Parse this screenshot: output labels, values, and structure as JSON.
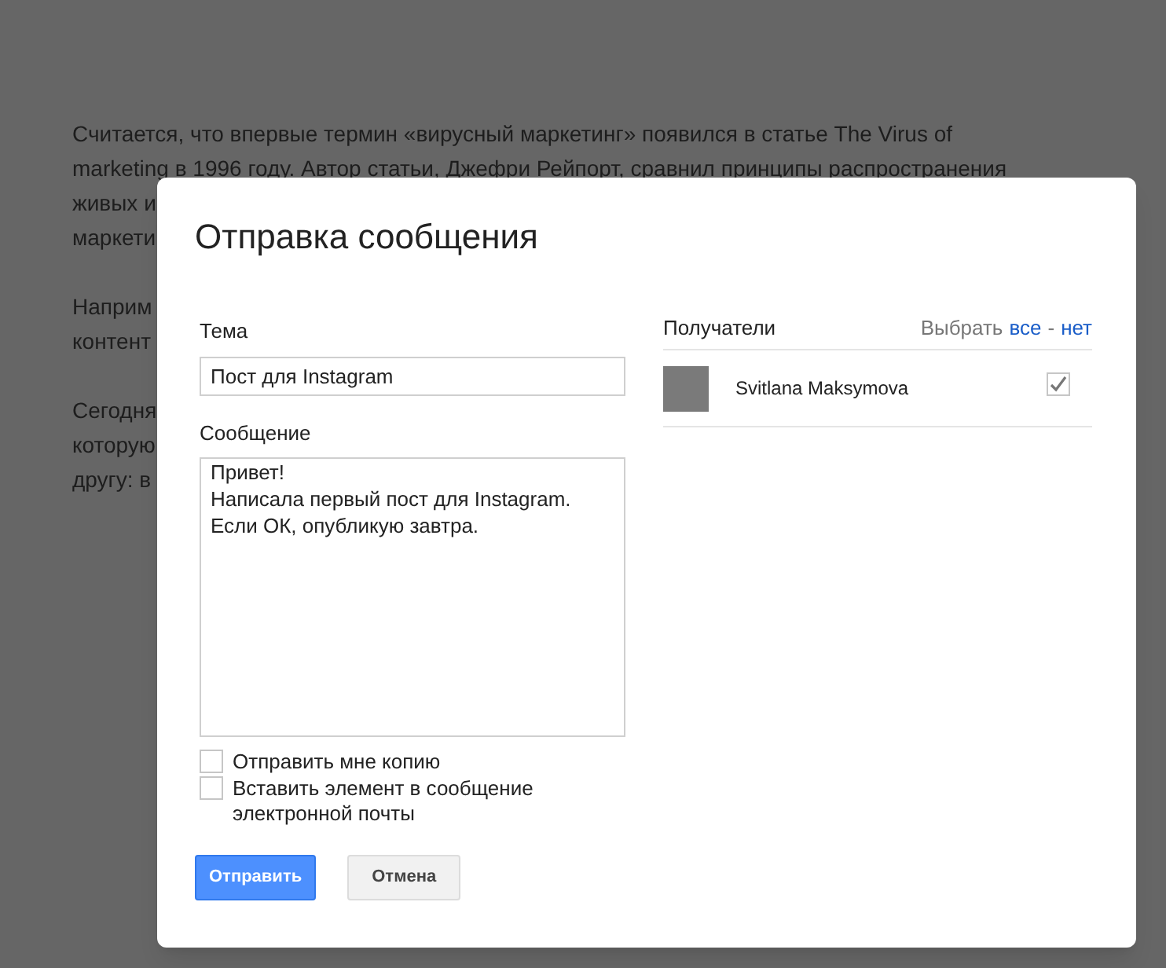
{
  "document": {
    "paragraphs": [
      {
        "lines": [
          {
            "text": "Считается, что впервые термин «вирусный маркетинг» появился в статье The Virus of"
          },
          {
            "text": "marketing в 1996 году. Автор статьи, ",
            "link": "Джефри Рейпорт",
            "after": ", сравнил принципы распространения"
          },
          {
            "text": "живых и"
          },
          {
            "text": "маркети"
          }
        ]
      },
      {
        "lines": [
          {
            "text": "Наприм"
          },
          {
            "text": "контент"
          }
        ]
      },
      {
        "lines": [
          {
            "text": "Сегодня"
          },
          {
            "text": "которую"
          },
          {
            "text": "другу: в"
          }
        ]
      }
    ]
  },
  "dialog": {
    "title": "Отправка сообщения",
    "subject": {
      "label": "Тема",
      "value": "Пост для Instagram"
    },
    "message": {
      "label": "Сообщение",
      "value": "Привет!\nНаписала первый пост для Instagram.\nЕсли ОК, опубликую завтра."
    },
    "options": [
      {
        "label": "Отправить мне копию",
        "checked": false
      },
      {
        "label": "Вставить элемент в сообщение электронной почты",
        "checked": false
      }
    ],
    "recipients": {
      "label": "Получатели",
      "select_label": "Выбрать",
      "select_all": "все",
      "separator": "-",
      "select_none": "нет",
      "items": [
        {
          "name": "Svitlana Maksymova",
          "checked": true
        }
      ]
    },
    "buttons": [
      {
        "label": "Отправить",
        "kind": "primary"
      },
      {
        "label": "Отмена",
        "kind": "secondary"
      }
    ]
  }
}
